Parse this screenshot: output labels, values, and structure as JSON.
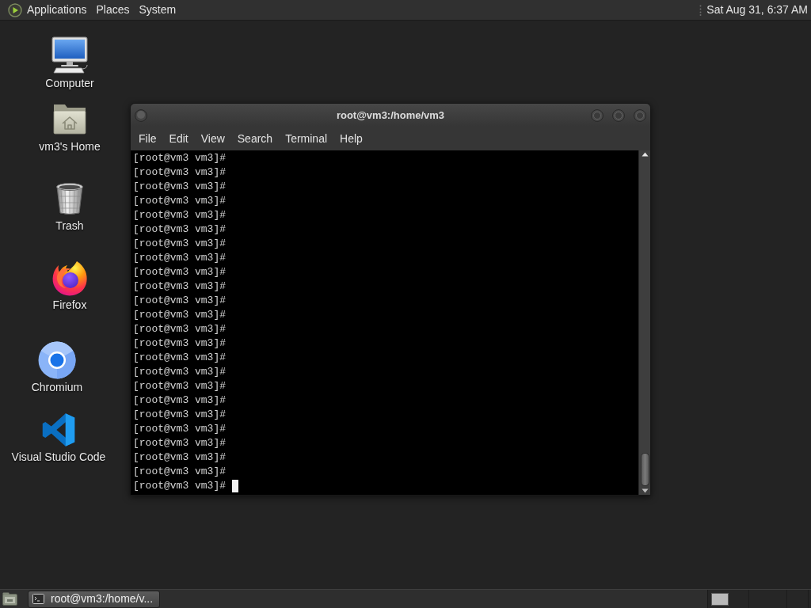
{
  "top_panel": {
    "menus": [
      "Applications",
      "Places",
      "System"
    ],
    "clock": "Sat Aug 31, 6:37 AM"
  },
  "desktop_icons": [
    {
      "kind": "computer",
      "label": "Computer"
    },
    {
      "kind": "home",
      "label": "vm3's Home"
    },
    {
      "kind": "trash",
      "label": "Trash"
    },
    {
      "kind": "firefox",
      "label": "Firefox"
    },
    {
      "kind": "chromium",
      "label": "Chromium"
    },
    {
      "kind": "vscode",
      "label": "Visual Studio Code"
    }
  ],
  "terminal_window": {
    "title": "root@vm3:/home/vm3",
    "menu": [
      "File",
      "Edit",
      "View",
      "Search",
      "Terminal",
      "Help"
    ],
    "lines": [
      {
        "text": "[root@vm3 vm3]#",
        "cursor": false
      },
      {
        "text": "[root@vm3 vm3]#",
        "cursor": false
      },
      {
        "text": "[root@vm3 vm3]#",
        "cursor": false
      },
      {
        "text": "[root@vm3 vm3]#",
        "cursor": false
      },
      {
        "text": "[root@vm3 vm3]#",
        "cursor": false
      },
      {
        "text": "[root@vm3 vm3]#",
        "cursor": false
      },
      {
        "text": "[root@vm3 vm3]#",
        "cursor": false
      },
      {
        "text": "[root@vm3 vm3]#",
        "cursor": false
      },
      {
        "text": "[root@vm3 vm3]#",
        "cursor": false
      },
      {
        "text": "[root@vm3 vm3]#",
        "cursor": false
      },
      {
        "text": "[root@vm3 vm3]#",
        "cursor": false
      },
      {
        "text": "[root@vm3 vm3]#",
        "cursor": false
      },
      {
        "text": "[root@vm3 vm3]#",
        "cursor": false
      },
      {
        "text": "[root@vm3 vm3]#",
        "cursor": false
      },
      {
        "text": "[root@vm3 vm3]#",
        "cursor": false
      },
      {
        "text": "[root@vm3 vm3]#",
        "cursor": false
      },
      {
        "text": "[root@vm3 vm3]#",
        "cursor": false
      },
      {
        "text": "[root@vm3 vm3]#",
        "cursor": false
      },
      {
        "text": "[root@vm3 vm3]#",
        "cursor": false
      },
      {
        "text": "[root@vm3 vm3]#",
        "cursor": false
      },
      {
        "text": "[root@vm3 vm3]#",
        "cursor": false
      },
      {
        "text": "[root@vm3 vm3]#",
        "cursor": false
      },
      {
        "text": "[root@vm3 vm3]#",
        "cursor": false
      },
      {
        "text": "[root@vm3 vm3]#",
        "cursor": true
      }
    ]
  },
  "taskbar": {
    "tasks": [
      {
        "label": "root@vm3:/home/v...",
        "selected": true
      }
    ]
  }
}
